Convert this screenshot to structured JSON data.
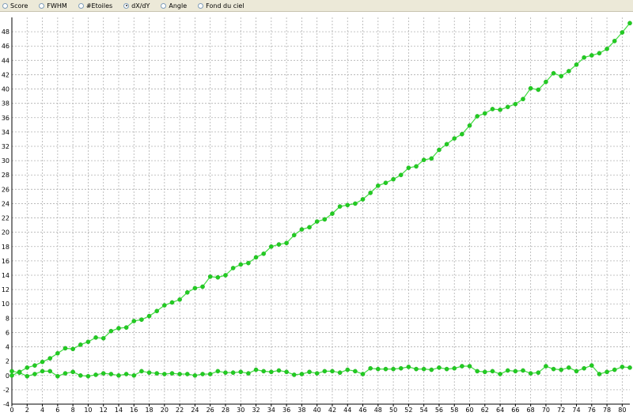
{
  "toolbar": {
    "options": [
      {
        "label": "Score",
        "checked": false
      },
      {
        "label": "FWHM",
        "checked": false
      },
      {
        "label": "#Etoiles",
        "checked": false
      },
      {
        "label": "dX/dY",
        "checked": true
      },
      {
        "label": "Angle",
        "checked": false
      },
      {
        "label": "Fond du ciel",
        "checked": false
      }
    ]
  },
  "colors": {
    "series": "#3fdc3f",
    "marker": "#22cc22",
    "grid": "#b0b0b0"
  },
  "chart_data": {
    "type": "line",
    "title": "",
    "xlabel": "",
    "ylabel": "",
    "xlim": [
      0,
      81
    ],
    "ylim": [
      -4,
      50
    ],
    "x_ticks": [
      0,
      2,
      4,
      6,
      8,
      10,
      12,
      14,
      16,
      18,
      20,
      22,
      24,
      26,
      28,
      30,
      32,
      34,
      36,
      38,
      40,
      42,
      44,
      46,
      48,
      50,
      52,
      54,
      56,
      58,
      60,
      62,
      64,
      66,
      68,
      70,
      72,
      74,
      76,
      78,
      80
    ],
    "y_ticks": [
      -4,
      -2,
      0,
      2,
      4,
      6,
      8,
      10,
      12,
      14,
      16,
      18,
      20,
      22,
      24,
      26,
      28,
      30,
      32,
      34,
      36,
      38,
      40,
      42,
      44,
      46,
      48
    ],
    "grid": true,
    "series": [
      {
        "values": [
          0.0,
          0.5,
          1.1,
          1.4,
          1.9,
          2.4,
          3.1,
          3.8,
          3.7,
          4.3,
          4.7,
          5.3,
          5.2,
          6.2,
          6.6,
          6.7,
          7.6,
          7.8,
          8.3,
          9.0,
          9.8,
          10.2,
          10.6,
          11.6,
          12.2,
          12.4,
          13.8,
          13.7,
          14.0,
          15.0,
          15.5,
          15.7,
          16.5,
          17.0,
          18.0,
          18.3,
          18.5,
          19.6,
          20.4,
          20.7,
          21.5,
          21.8,
          22.6,
          23.6,
          23.8,
          24.0,
          24.6,
          25.5,
          26.5,
          26.9,
          27.4,
          28.0,
          29.0,
          29.2,
          30.1,
          30.3,
          31.5,
          32.3,
          33.1,
          33.7,
          34.9,
          36.2,
          36.6,
          37.2,
          37.1,
          37.5,
          37.9,
          38.6,
          40.1,
          39.9,
          41.0,
          42.2,
          41.8,
          42.5,
          43.4,
          44.4,
          44.7,
          45.0,
          45.6,
          46.7,
          47.9,
          49.2
        ]
      },
      {
        "values": [
          0.6,
          0.4,
          -0.1,
          0.2,
          0.6,
          0.6,
          -0.1,
          0.3,
          0.5,
          0.0,
          -0.1,
          0.1,
          0.3,
          0.2,
          0.0,
          0.2,
          0.0,
          0.6,
          0.4,
          0.3,
          0.2,
          0.3,
          0.2,
          0.2,
          0.0,
          0.2,
          0.2,
          0.6,
          0.4,
          0.4,
          0.5,
          0.3,
          0.8,
          0.6,
          0.5,
          0.7,
          0.5,
          0.1,
          0.2,
          0.5,
          0.3,
          0.6,
          0.6,
          0.4,
          0.8,
          0.6,
          0.2,
          1.0,
          0.9,
          0.9,
          0.9,
          1.0,
          1.2,
          0.9,
          0.9,
          0.8,
          1.1,
          0.9,
          1.0,
          1.3,
          1.3,
          0.6,
          0.5,
          0.6,
          0.2,
          0.7,
          0.6,
          0.7,
          0.3,
          0.4,
          1.3,
          0.9,
          0.8,
          1.1,
          0.6,
          1.0,
          1.4,
          0.2,
          0.5,
          0.8,
          1.2,
          1.1
        ]
      }
    ]
  }
}
